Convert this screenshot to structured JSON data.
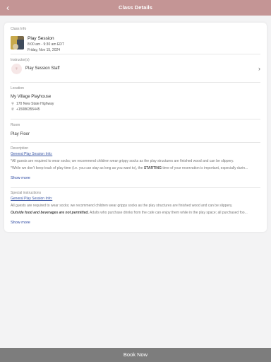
{
  "header": {
    "back_icon": "chevron-left",
    "title": "Class Details"
  },
  "class_info": {
    "label": "Class Info",
    "name": "Play Session",
    "time": "8:00 am - 9:30 am EDT",
    "date": "Friday, Nov 15, 2024"
  },
  "instructors": {
    "label": "Instructor(s)",
    "name": "Play Session Staff",
    "chevron_icon": "chevron-right"
  },
  "location": {
    "label": "Location",
    "name": "My Village Playhouse",
    "address": "170 New State Highway",
    "phone": "+15086355445"
  },
  "room": {
    "label": "Room",
    "value": "Play Floor"
  },
  "description": {
    "label": "Description",
    "link": "General Play Session Info:",
    "line1": "*All guests are required to wear socks; we recommend children wear grippy socks as the play structures are finished wood and can be slippery.",
    "line2_a": "*While we don't keep track of play time (i.e. you can stay as long as you want to), the ",
    "line2_bold": "STARTING",
    "line2_b": " time of your reservation is important, especially durin...",
    "show_more": "Show more"
  },
  "special": {
    "label": "Special instructions",
    "link": "General Play Session Info:",
    "line1": "  All guests are required to wear socks; we recommend children wear grippy socks as the play structures are finished wood and can be slippery.",
    "line2_bold": "Outside food and beverages are not permitted.",
    "line2_rest": " Adults who purchase drinks from the cafe can enjoy them while in the play space; all purchased foo...",
    "show_more": "Show more"
  },
  "footer": {
    "button": "Book Now"
  },
  "colors": {
    "header": "#c49595",
    "footer": "#7d7d7d",
    "link": "#3a57a6"
  }
}
